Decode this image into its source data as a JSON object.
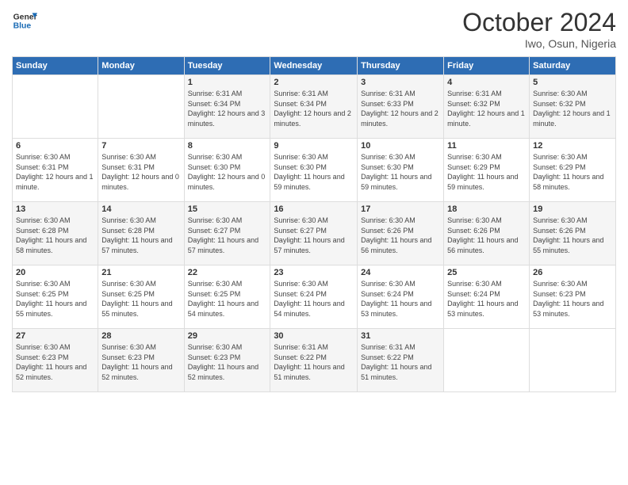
{
  "header": {
    "logo_general": "General",
    "logo_blue": "Blue",
    "month": "October 2024",
    "location": "Iwo, Osun, Nigeria"
  },
  "days_of_week": [
    "Sunday",
    "Monday",
    "Tuesday",
    "Wednesday",
    "Thursday",
    "Friday",
    "Saturday"
  ],
  "weeks": [
    [
      {
        "day": "",
        "sunrise": "",
        "sunset": "",
        "daylight": ""
      },
      {
        "day": "",
        "sunrise": "",
        "sunset": "",
        "daylight": ""
      },
      {
        "day": "1",
        "sunrise": "Sunrise: 6:31 AM",
        "sunset": "Sunset: 6:34 PM",
        "daylight": "Daylight: 12 hours and 3 minutes."
      },
      {
        "day": "2",
        "sunrise": "Sunrise: 6:31 AM",
        "sunset": "Sunset: 6:34 PM",
        "daylight": "Daylight: 12 hours and 2 minutes."
      },
      {
        "day": "3",
        "sunrise": "Sunrise: 6:31 AM",
        "sunset": "Sunset: 6:33 PM",
        "daylight": "Daylight: 12 hours and 2 minutes."
      },
      {
        "day": "4",
        "sunrise": "Sunrise: 6:31 AM",
        "sunset": "Sunset: 6:32 PM",
        "daylight": "Daylight: 12 hours and 1 minute."
      },
      {
        "day": "5",
        "sunrise": "Sunrise: 6:30 AM",
        "sunset": "Sunset: 6:32 PM",
        "daylight": "Daylight: 12 hours and 1 minute."
      }
    ],
    [
      {
        "day": "6",
        "sunrise": "Sunrise: 6:30 AM",
        "sunset": "Sunset: 6:31 PM",
        "daylight": "Daylight: 12 hours and 1 minute."
      },
      {
        "day": "7",
        "sunrise": "Sunrise: 6:30 AM",
        "sunset": "Sunset: 6:31 PM",
        "daylight": "Daylight: 12 hours and 0 minutes."
      },
      {
        "day": "8",
        "sunrise": "Sunrise: 6:30 AM",
        "sunset": "Sunset: 6:30 PM",
        "daylight": "Daylight: 12 hours and 0 minutes."
      },
      {
        "day": "9",
        "sunrise": "Sunrise: 6:30 AM",
        "sunset": "Sunset: 6:30 PM",
        "daylight": "Daylight: 11 hours and 59 minutes."
      },
      {
        "day": "10",
        "sunrise": "Sunrise: 6:30 AM",
        "sunset": "Sunset: 6:30 PM",
        "daylight": "Daylight: 11 hours and 59 minutes."
      },
      {
        "day": "11",
        "sunrise": "Sunrise: 6:30 AM",
        "sunset": "Sunset: 6:29 PM",
        "daylight": "Daylight: 11 hours and 59 minutes."
      },
      {
        "day": "12",
        "sunrise": "Sunrise: 6:30 AM",
        "sunset": "Sunset: 6:29 PM",
        "daylight": "Daylight: 11 hours and 58 minutes."
      }
    ],
    [
      {
        "day": "13",
        "sunrise": "Sunrise: 6:30 AM",
        "sunset": "Sunset: 6:28 PM",
        "daylight": "Daylight: 11 hours and 58 minutes."
      },
      {
        "day": "14",
        "sunrise": "Sunrise: 6:30 AM",
        "sunset": "Sunset: 6:28 PM",
        "daylight": "Daylight: 11 hours and 57 minutes."
      },
      {
        "day": "15",
        "sunrise": "Sunrise: 6:30 AM",
        "sunset": "Sunset: 6:27 PM",
        "daylight": "Daylight: 11 hours and 57 minutes."
      },
      {
        "day": "16",
        "sunrise": "Sunrise: 6:30 AM",
        "sunset": "Sunset: 6:27 PM",
        "daylight": "Daylight: 11 hours and 57 minutes."
      },
      {
        "day": "17",
        "sunrise": "Sunrise: 6:30 AM",
        "sunset": "Sunset: 6:26 PM",
        "daylight": "Daylight: 11 hours and 56 minutes."
      },
      {
        "day": "18",
        "sunrise": "Sunrise: 6:30 AM",
        "sunset": "Sunset: 6:26 PM",
        "daylight": "Daylight: 11 hours and 56 minutes."
      },
      {
        "day": "19",
        "sunrise": "Sunrise: 6:30 AM",
        "sunset": "Sunset: 6:26 PM",
        "daylight": "Daylight: 11 hours and 55 minutes."
      }
    ],
    [
      {
        "day": "20",
        "sunrise": "Sunrise: 6:30 AM",
        "sunset": "Sunset: 6:25 PM",
        "daylight": "Daylight: 11 hours and 55 minutes."
      },
      {
        "day": "21",
        "sunrise": "Sunrise: 6:30 AM",
        "sunset": "Sunset: 6:25 PM",
        "daylight": "Daylight: 11 hours and 55 minutes."
      },
      {
        "day": "22",
        "sunrise": "Sunrise: 6:30 AM",
        "sunset": "Sunset: 6:25 PM",
        "daylight": "Daylight: 11 hours and 54 minutes."
      },
      {
        "day": "23",
        "sunrise": "Sunrise: 6:30 AM",
        "sunset": "Sunset: 6:24 PM",
        "daylight": "Daylight: 11 hours and 54 minutes."
      },
      {
        "day": "24",
        "sunrise": "Sunrise: 6:30 AM",
        "sunset": "Sunset: 6:24 PM",
        "daylight": "Daylight: 11 hours and 53 minutes."
      },
      {
        "day": "25",
        "sunrise": "Sunrise: 6:30 AM",
        "sunset": "Sunset: 6:24 PM",
        "daylight": "Daylight: 11 hours and 53 minutes."
      },
      {
        "day": "26",
        "sunrise": "Sunrise: 6:30 AM",
        "sunset": "Sunset: 6:23 PM",
        "daylight": "Daylight: 11 hours and 53 minutes."
      }
    ],
    [
      {
        "day": "27",
        "sunrise": "Sunrise: 6:30 AM",
        "sunset": "Sunset: 6:23 PM",
        "daylight": "Daylight: 11 hours and 52 minutes."
      },
      {
        "day": "28",
        "sunrise": "Sunrise: 6:30 AM",
        "sunset": "Sunset: 6:23 PM",
        "daylight": "Daylight: 11 hours and 52 minutes."
      },
      {
        "day": "29",
        "sunrise": "Sunrise: 6:30 AM",
        "sunset": "Sunset: 6:23 PM",
        "daylight": "Daylight: 11 hours and 52 minutes."
      },
      {
        "day": "30",
        "sunrise": "Sunrise: 6:31 AM",
        "sunset": "Sunset: 6:22 PM",
        "daylight": "Daylight: 11 hours and 51 minutes."
      },
      {
        "day": "31",
        "sunrise": "Sunrise: 6:31 AM",
        "sunset": "Sunset: 6:22 PM",
        "daylight": "Daylight: 11 hours and 51 minutes."
      },
      {
        "day": "",
        "sunrise": "",
        "sunset": "",
        "daylight": ""
      },
      {
        "day": "",
        "sunrise": "",
        "sunset": "",
        "daylight": ""
      }
    ]
  ]
}
